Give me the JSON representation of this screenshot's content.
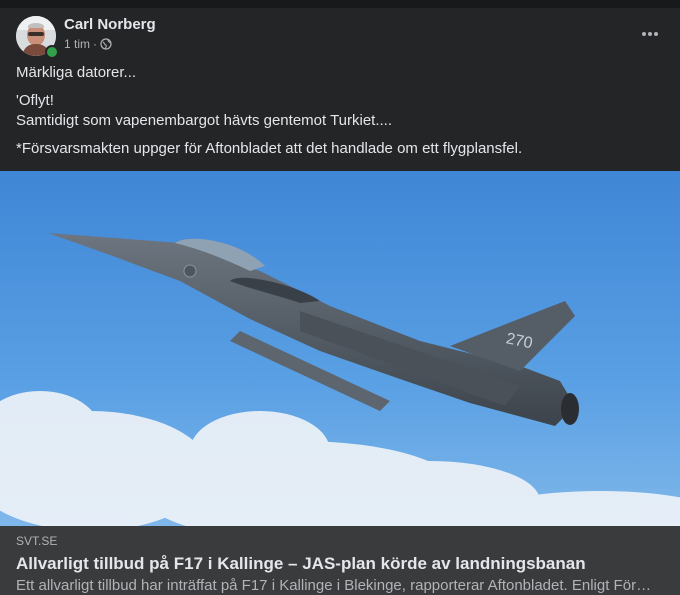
{
  "post": {
    "author": "Carl Norberg",
    "time": "1 tim",
    "separator": "·",
    "privacy_icon": "globe-icon",
    "more_icon": "more-horizontal-icon",
    "text": {
      "line1": "Märkliga datorer...",
      "line2": "'Oflyt!",
      "line3": "Samtidigt som vapenembargot hävts gentemot Turkiet....",
      "line4": "*Försvarsmakten uppger för Aftonbladet att det handlade om ett flygplansfel."
    },
    "image": {
      "tail_number": "270"
    }
  },
  "link": {
    "domain": "SVT.SE",
    "title": "Allvarligt tillbud på F17 i Kallinge – JAS-plan körde av landningsbanan",
    "description": "Ett allvarligt tillbud har inträffat på F17 i Kallinge i Blekinge, rapporterar Aftonbladet. Enligt Försvarsmakten..."
  },
  "colors": {
    "background": "#242526",
    "link_card": "#3a3b3c",
    "online": "#31a24c",
    "sky": "#4a8fd8"
  }
}
